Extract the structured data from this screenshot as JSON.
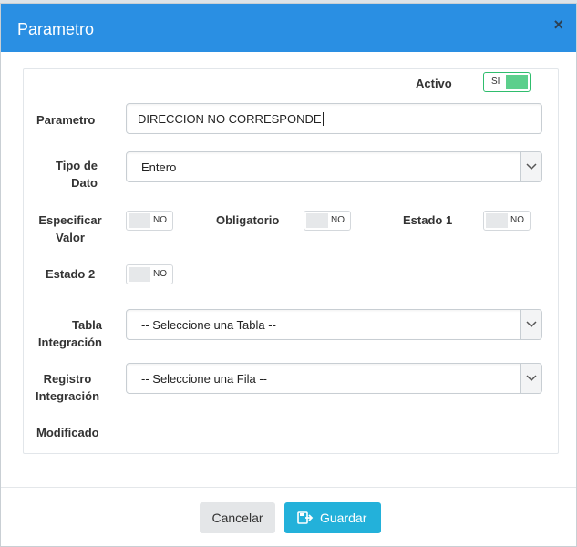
{
  "modal": {
    "title": "Parametro",
    "close_glyph": "×"
  },
  "form": {
    "activo": {
      "label": "Activo",
      "state": "SI"
    },
    "parametro": {
      "label": "Parametro",
      "value": "DIRECCION NO CORRESPONDE"
    },
    "tipo_dato": {
      "label_line1": "Tipo de",
      "label_line2": "Dato",
      "selected": "Entero"
    },
    "especificar_valor": {
      "label_line1": "Especificar",
      "label_line2": "Valor",
      "state": "NO"
    },
    "obligatorio": {
      "label": "Obligatorio",
      "state": "NO"
    },
    "estado1": {
      "label": "Estado 1",
      "state": "NO"
    },
    "estado2": {
      "label": "Estado 2",
      "state": "NO"
    },
    "tabla_integracion": {
      "label_line1": "Tabla",
      "label_line2": "Integración",
      "selected": "-- Seleccione una Tabla --"
    },
    "registro_integracion": {
      "label_line1": "Registro",
      "label_line2": "Integración",
      "selected": "-- Seleccione una Fila --"
    },
    "modificado": {
      "label": "Modificado"
    }
  },
  "footer": {
    "cancel_label": "Cancelar",
    "save_label": "Guardar"
  },
  "icons": {
    "close": "close-icon",
    "dropdown": "chevron-down-icon",
    "save": "save-icon"
  },
  "colors": {
    "header": "#2a8fe3",
    "save_button": "#23b1da",
    "toggle_on": "#5ccf8c"
  }
}
